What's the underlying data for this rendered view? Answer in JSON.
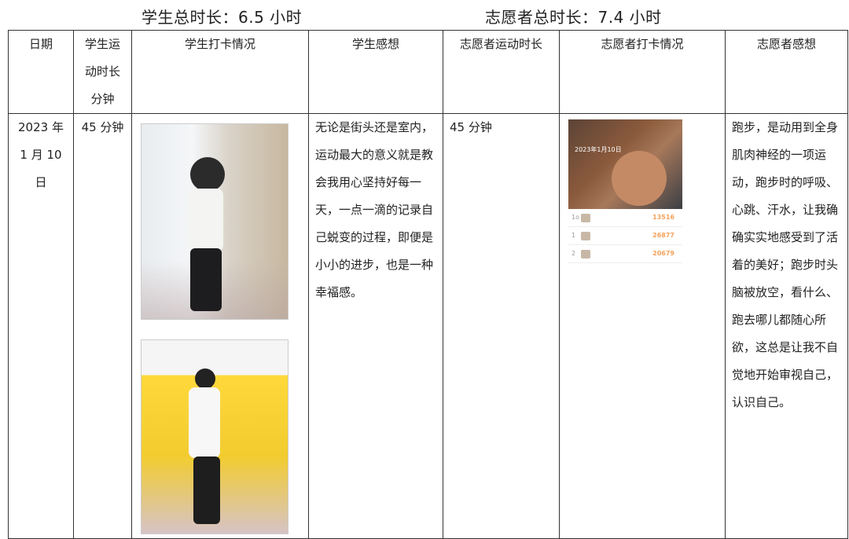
{
  "summary": {
    "student_total": "学生总时长：6.5 小时",
    "volunteer_total": "志愿者总时长：7.4 小时"
  },
  "table": {
    "headers": [
      "日期",
      "学生运动时长分钟",
      "学生打卡情况",
      "学生感想",
      "志愿者运动时长",
      "志愿者打卡情况",
      "志愿者感想"
    ],
    "rows": [
      {
        "date": "2023 年 1 月 10 日",
        "student_minutes": "45 分钟",
        "student_thoughts": "无论是街头还是室内，运动最大的意义就是教会我用心坚持好每一天，一点一滴的记录自己蜕变的过程，即便是小小的进步，也是一种幸福感。",
        "volunteer_minutes": "45 分钟",
        "volunteer_thoughts": "跑步，是动用到全身肌肉神经的一项运动，跑步时的呼吸、心跳、汗水，让我确确实实地感受到了活着的美好；跑步时头脑被放空，看什么、跑去哪儿都随心所欲，这总是让我不自觉地开始审视自己，认识自己。"
      }
    ]
  },
  "volunteer_app": {
    "date_label": "2023年1月10日",
    "ranks": [
      {
        "rank": "1o",
        "name": "",
        "score": "13516"
      },
      {
        "rank": "1",
        "name": "",
        "score": "26877"
      },
      {
        "rank": "2",
        "name": "",
        "score": "20679"
      }
    ]
  }
}
